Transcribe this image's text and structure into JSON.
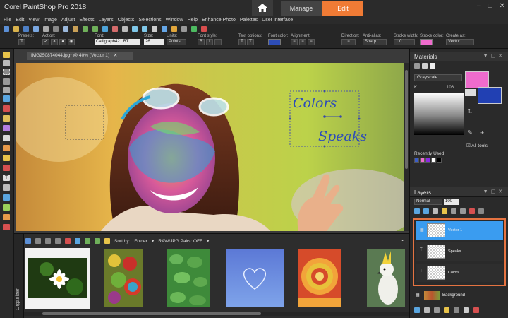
{
  "app": {
    "title": "Corel PaintShop Pro 2018"
  },
  "workspace_tabs": [
    {
      "label": "Manage"
    },
    {
      "label": "Edit"
    }
  ],
  "menu": [
    "File",
    "Edit",
    "View",
    "Image",
    "Adjust",
    "Effects",
    "Layers",
    "Objects",
    "Selections",
    "Window",
    "Help",
    "Enhance Photo",
    "Palettes",
    "User Interface"
  ],
  "tool_options": {
    "presets_label": "Presets:",
    "action_label": "Action:",
    "font_label": "Font:",
    "font_value": "Calligraph421 BT",
    "size_label": "Size:",
    "size_value": "26",
    "units_label": "Units:",
    "units_value": "Points",
    "font_style_label": "Font style:",
    "text_options_label": "Text options:",
    "font_color_label": "Font color:",
    "alignment_label": "Alignment:",
    "direction_label": "Direction:",
    "anti_alias_label": "Anti-alias:",
    "anti_alias_value": "Sharp",
    "stroke_width_label": "Stroke width:",
    "stroke_width_value": "1.0",
    "stroke_color_label": "Stroke color:",
    "create_as_label": "Create as:",
    "create_as_value": "Vector",
    "font_color": "#2d4db8",
    "stroke_color": "#ee6bcc"
  },
  "document": {
    "tab_label": "IMG250874044.jpg* @ 40% (Vector 1)",
    "text_colors": "Colors",
    "text_speaks": "Speaks"
  },
  "organizer": {
    "side_label": "Organizer",
    "sort_by_label": "Sort by:",
    "sort_by_value": "Folder",
    "raw_jpg_label": "RAW/JPG Pairs: OFF"
  },
  "materials": {
    "title": "Materials",
    "palette_value": "Grayscale",
    "k_label": "K",
    "k_value": "106",
    "all_tools_label": "All tools",
    "recently_used_label": "Recently Used",
    "foreground_color": "#ee6bcc",
    "background_color": "#2140b3",
    "recent_colors": [
      "#3a5cc7",
      "#ee6bcc",
      "#8a2be2",
      "#ffffff",
      "#000000"
    ]
  },
  "layers": {
    "title": "Layers",
    "blend_mode": "Normal",
    "opacity": "100",
    "items": [
      {
        "name": "Vector 1",
        "kind": "group"
      },
      {
        "name": "Speaks",
        "kind": "text"
      },
      {
        "name": "Colors",
        "kind": "text"
      },
      {
        "name": "Background",
        "kind": "raster"
      }
    ]
  }
}
